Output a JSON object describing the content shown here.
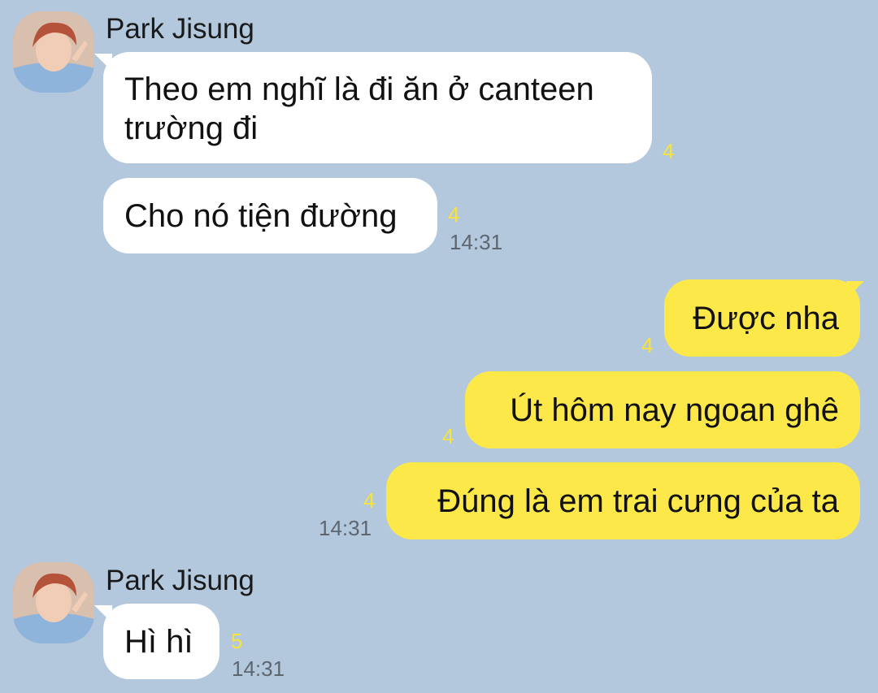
{
  "chat": {
    "groups": [
      {
        "sender": "Park Jisung",
        "messages": [
          {
            "text_lines": [
              "Theo em nghĩ là đi ăn ở canteen",
              "trường đi"
            ],
            "unread": "4"
          },
          {
            "text": "Cho nó tiện đường",
            "unread": "4",
            "time": "14:31"
          }
        ]
      },
      {
        "messages": [
          {
            "text": "Được nha",
            "unread": "4"
          },
          {
            "text": "Út hôm nay ngoan ghê",
            "unread": "4"
          },
          {
            "text": "Đúng là em trai cưng của ta",
            "unread": "4",
            "time": "14:31"
          }
        ]
      },
      {
        "sender": "Park Jisung",
        "messages": [
          {
            "text": "Hì hì",
            "unread": "5",
            "time": "14:31"
          }
        ]
      }
    ]
  },
  "colors": {
    "background": "#b3c8dc",
    "incoming_bubble": "#ffffff",
    "outgoing_bubble": "#fde84a",
    "unread_count": "#f6e33d",
    "timestamp": "#5d6670"
  },
  "icons": {
    "avatar": "profile-photo"
  }
}
